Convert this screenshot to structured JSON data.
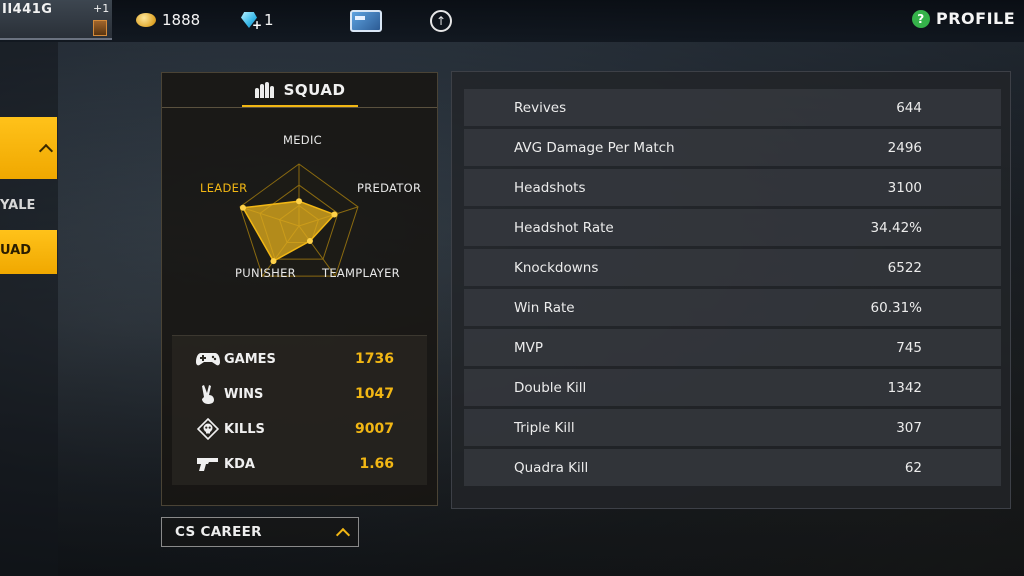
{
  "topbar": {
    "player_name": "II441G",
    "player_level_plus": "+1",
    "gold": "1888",
    "diamonds": "1",
    "profile_label": "PROFILE",
    "help_glyph": "?"
  },
  "mode_strip": {
    "items": [
      {
        "label": "YALE"
      },
      {
        "label": "UAD"
      }
    ]
  },
  "squad_panel": {
    "title": "SQUAD",
    "radar": {
      "axes": [
        {
          "label": "MEDIC",
          "value": 0.4
        },
        {
          "label": "PREDATOR",
          "value": 0.6
        },
        {
          "label": "TEAMPLAYER",
          "value": 0.3
        },
        {
          "label": "PUNISHER",
          "value": 0.7
        },
        {
          "label": "LEADER",
          "value": 0.95
        }
      ],
      "highlighted_axis": "LEADER",
      "accent_color": "#f2b714"
    },
    "stats": [
      {
        "icon": "gamepad-icon",
        "label": "GAMES",
        "value": "1736"
      },
      {
        "icon": "victory-hand-icon",
        "label": "WINS",
        "value": "1047"
      },
      {
        "icon": "skull-icon",
        "label": "KILLS",
        "value": "9007"
      },
      {
        "icon": "pistol-icon",
        "label": "KDA",
        "value": "1.66"
      }
    ]
  },
  "career_dropdown": {
    "label": "CS CAREER"
  },
  "details": [
    {
      "label": "Revives",
      "value": "644"
    },
    {
      "label": "AVG Damage Per Match",
      "value": "2496"
    },
    {
      "label": "Headshots",
      "value": "3100"
    },
    {
      "label": "Headshot Rate",
      "value": "34.42%"
    },
    {
      "label": "Knockdowns",
      "value": "6522"
    },
    {
      "label": "Win Rate",
      "value": "60.31%"
    },
    {
      "label": "MVP",
      "value": "745"
    },
    {
      "label": "Double Kill",
      "value": "1342"
    },
    {
      "label": "Triple Kill",
      "value": "307"
    },
    {
      "label": "Quadra Kill",
      "value": "62"
    }
  ],
  "colors": {
    "accent": "#f2b714",
    "active_tab": "#ffc21a",
    "help_green": "#35b24a"
  }
}
